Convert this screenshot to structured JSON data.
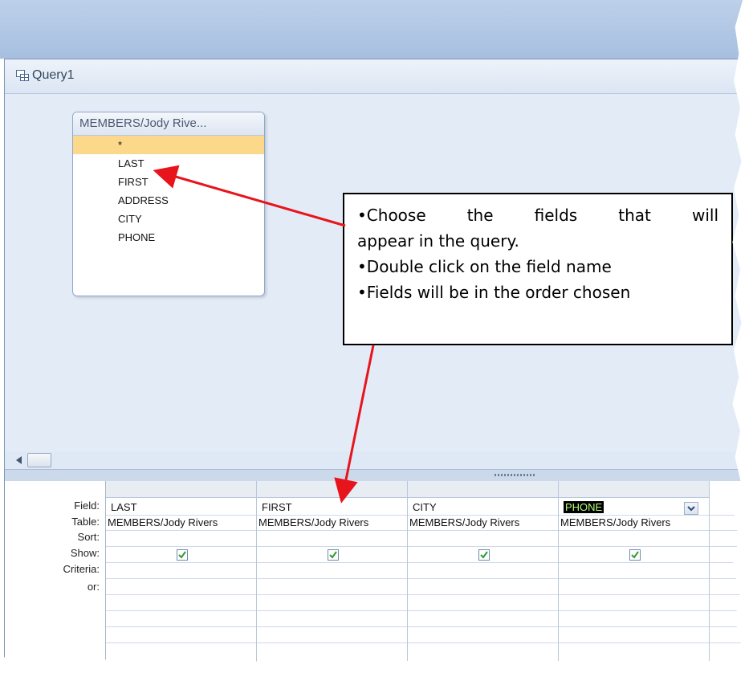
{
  "window": {
    "title": "Query1",
    "icon": "query-icon"
  },
  "table_box": {
    "title": "MEMBERS/Jody Rive...",
    "fields": [
      "*",
      "LAST",
      "FIRST",
      "ADDRESS",
      "CITY",
      "PHONE"
    ]
  },
  "grid": {
    "row_labels": {
      "field": "Field:",
      "table": "Table:",
      "sort": "Sort:",
      "show": "Show:",
      "criteria": "Criteria:",
      "or": "or:"
    },
    "columns": [
      {
        "field": "LAST",
        "table": "MEMBERS/Jody Rivers",
        "show": true
      },
      {
        "field": "FIRST",
        "table": "MEMBERS/Jody Rivers",
        "show": true
      },
      {
        "field": "CITY",
        "table": "MEMBERS/Jody Rivers",
        "show": true
      },
      {
        "field": "PHONE",
        "table": "MEMBERS/Jody Rivers",
        "show": true
      }
    ]
  },
  "callout": {
    "line1": "•Choose the fields that will",
    "line2": "appear in the query.",
    "line3": "•Double click on the field name",
    "line4": "•Fields will be in the order chosen"
  },
  "colors": {
    "arrow": "#e8141b",
    "highlight_row": "#fbd88a",
    "check": "#2e9a2e"
  }
}
